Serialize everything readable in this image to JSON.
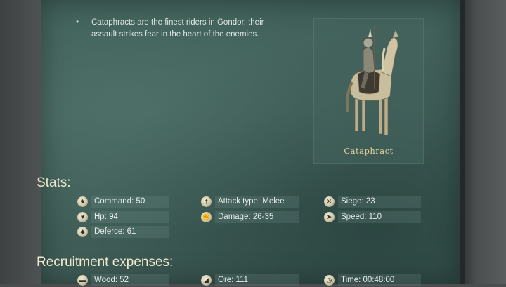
{
  "description": "Cataphracts are the finest riders in Gondor, their assault strikes fear in the heart of the enemies.",
  "unit": {
    "name": "Cataphract"
  },
  "stats": {
    "title": "Stats:",
    "command": "Command: 50",
    "attack_type": "Attack type: Melee",
    "siege": "Siege: 23",
    "hp": "Hp: 94",
    "damage": "Damage: 26-35",
    "speed": "Speed: 110",
    "defence": "Deferce: 61"
  },
  "recruitment": {
    "title": "Recruitment expenses:",
    "wood": "Wood: 52",
    "ore": "Ore: 111",
    "time": "Time: 00:48:00"
  },
  "icons": {
    "command": "horse-head-icon",
    "attack_type": "sword-icon",
    "siege": "crossed-axes-icon",
    "hp": "heart-icon",
    "damage": "fist-icon",
    "speed": "running-icon",
    "defence": "shield-icon",
    "wood": "log-icon",
    "ore": "ore-icon",
    "time": "clock-icon"
  },
  "colors": {
    "panel": "#46655e",
    "title": "#f1e9cf",
    "unit_name": "#e8d49b"
  }
}
